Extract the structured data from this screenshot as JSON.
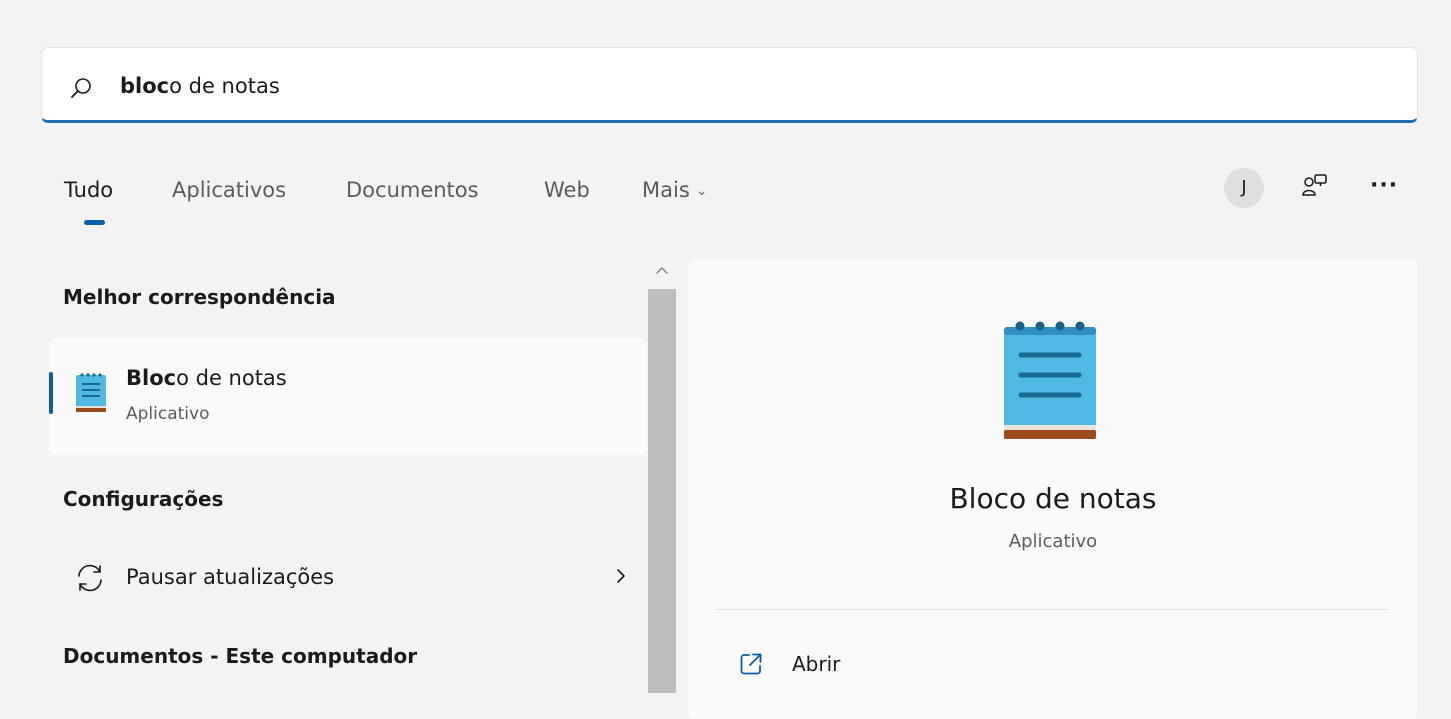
{
  "search": {
    "typed": "bloc",
    "completion": "o de notas"
  },
  "tabs": [
    {
      "label": "Tudo",
      "active": true
    },
    {
      "label": "Aplicativos",
      "active": false
    },
    {
      "label": "Documentos",
      "active": false
    },
    {
      "label": "Web",
      "active": false
    },
    {
      "label": "Mais",
      "active": false
    }
  ],
  "header_tools": {
    "avatar_initial": "J",
    "more_label": "···"
  },
  "results": {
    "best_match": {
      "section_title": "Melhor correspondência",
      "title_typed": "Bloc",
      "title_rest": "o de notas",
      "subtitle": "Aplicativo",
      "icon": "notepad-icon"
    },
    "settings": {
      "section_title": "Configurações",
      "items": [
        {
          "label": "Pausar atualizações",
          "icon": "sync-icon"
        }
      ]
    },
    "documents": {
      "section_title": "Documentos - Este computador"
    }
  },
  "preview": {
    "title": "Bloco de notas",
    "subtitle": "Aplicativo",
    "actions": [
      {
        "label": "Abrir",
        "icon": "open-external-icon"
      }
    ]
  },
  "colors": {
    "accent": "#0a5fa8",
    "search_underline": "#1d6eab",
    "background": "#f3f3f3",
    "notepad_blue": "#4fb8e3",
    "notepad_dark": "#1a6a93",
    "notepad_base": "#9a4a1c"
  }
}
